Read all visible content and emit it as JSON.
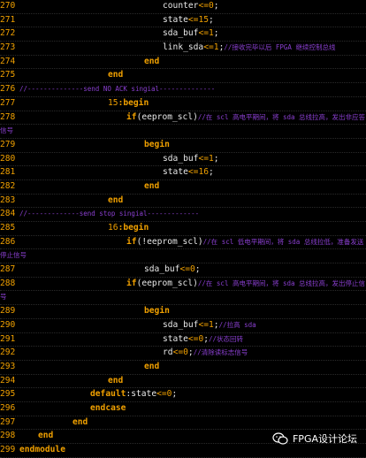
{
  "lines": [
    {
      "ln": "270",
      "indent": 184,
      "parts": [
        [
          "id",
          "counter"
        ],
        [
          "op",
          "<="
        ],
        [
          "num",
          "0"
        ],
        [
          "id",
          ";"
        ]
      ]
    },
    {
      "ln": "271",
      "indent": 184,
      "parts": [
        [
          "id",
          "state"
        ],
        [
          "op",
          "<="
        ],
        [
          "num",
          "15"
        ],
        [
          "id",
          ";"
        ]
      ]
    },
    {
      "ln": "272",
      "indent": 184,
      "parts": [
        [
          "id",
          "sda_buf"
        ],
        [
          "op",
          "<="
        ],
        [
          "num",
          "1"
        ],
        [
          "id",
          ";"
        ]
      ]
    },
    {
      "ln": "273",
      "indent": 184,
      "parts": [
        [
          "id",
          "link_sda"
        ],
        [
          "op",
          "<="
        ],
        [
          "num",
          "1"
        ],
        [
          "id",
          ";"
        ],
        [
          "cmt",
          "//接收完毕以后 FPGA 继续控制总线"
        ]
      ]
    },
    {
      "ln": "274",
      "indent": 163,
      "parts": [
        [
          "kw",
          "end"
        ]
      ]
    },
    {
      "ln": "275",
      "indent": 122,
      "parts": [
        [
          "kw",
          "end"
        ]
      ]
    },
    {
      "ln": "276",
      "indent": 22,
      "parts": [
        [
          "cmt",
          "//--------------send NO ACK singial--------------"
        ]
      ]
    },
    {
      "ln": "277",
      "indent": 122,
      "parts": [
        [
          "num",
          "15"
        ],
        [
          "kw",
          ":begin"
        ]
      ]
    },
    {
      "ln": "278",
      "indent": 143,
      "parts": [
        [
          "kw",
          "if"
        ],
        [
          "id",
          "(eeprom_scl)"
        ],
        [
          "cmt",
          "//在 scl 高电平期间，将 sda 总线拉高，发出非应答"
        ]
      ]
    },
    {
      "ln": "",
      "indent": 0,
      "parts": [
        [
          "cmt",
          "信号"
        ]
      ]
    },
    {
      "ln": "279",
      "indent": 163,
      "parts": [
        [
          "kw",
          "begin"
        ]
      ]
    },
    {
      "ln": "280",
      "indent": 184,
      "parts": [
        [
          "id",
          "sda_buf"
        ],
        [
          "op",
          "<="
        ],
        [
          "num",
          "1"
        ],
        [
          "id",
          ";"
        ]
      ]
    },
    {
      "ln": "281",
      "indent": 184,
      "parts": [
        [
          "id",
          "state"
        ],
        [
          "op",
          "<="
        ],
        [
          "num",
          "16"
        ],
        [
          "id",
          ";"
        ]
      ]
    },
    {
      "ln": "282",
      "indent": 163,
      "parts": [
        [
          "kw",
          "end"
        ]
      ]
    },
    {
      "ln": "283",
      "indent": 122,
      "parts": [
        [
          "kw",
          "end"
        ]
      ]
    },
    {
      "ln": "284",
      "indent": 22,
      "parts": [
        [
          "cmt",
          "//-------------send stop singial-------------"
        ]
      ]
    },
    {
      "ln": "285",
      "indent": 122,
      "parts": [
        [
          "num",
          "16"
        ],
        [
          "kw",
          ":begin"
        ]
      ]
    },
    {
      "ln": "286",
      "indent": 143,
      "parts": [
        [
          "kw",
          "if"
        ],
        [
          "id",
          "(!eeprom_scl)"
        ],
        [
          "cmt",
          "//在 scl 低电平期间，将 sda 总线拉低，准备发送"
        ]
      ]
    },
    {
      "ln": "",
      "indent": 0,
      "parts": [
        [
          "cmt",
          "停止信号"
        ]
      ]
    },
    {
      "ln": "287",
      "indent": 163,
      "parts": [
        [
          "id",
          "sda_buf"
        ],
        [
          "op",
          "<="
        ],
        [
          "num",
          "0"
        ],
        [
          "id",
          ";"
        ]
      ]
    },
    {
      "ln": "288",
      "indent": 143,
      "parts": [
        [
          "kw",
          "if"
        ],
        [
          "id",
          "(eeprom_scl)"
        ],
        [
          "cmt",
          "//在 scl 高电平期间，将 sda 总线拉高，发出停止信"
        ]
      ]
    },
    {
      "ln": "",
      "indent": 0,
      "parts": [
        [
          "cmt",
          "号"
        ]
      ]
    },
    {
      "ln": "289",
      "indent": 163,
      "parts": [
        [
          "kw",
          "begin"
        ]
      ]
    },
    {
      "ln": "290",
      "indent": 184,
      "parts": [
        [
          "id",
          "sda_buf"
        ],
        [
          "op",
          "<="
        ],
        [
          "num",
          "1"
        ],
        [
          "id",
          ";"
        ],
        [
          "cmt",
          "//拉高 sda"
        ]
      ]
    },
    {
      "ln": "291",
      "indent": 184,
      "parts": [
        [
          "id",
          "state"
        ],
        [
          "op",
          "<="
        ],
        [
          "num",
          "0"
        ],
        [
          "id",
          ";"
        ],
        [
          "cmt",
          "//状态回转"
        ]
      ]
    },
    {
      "ln": "292",
      "indent": 184,
      "parts": [
        [
          "id",
          "rd"
        ],
        [
          "op",
          "<="
        ],
        [
          "num",
          "0"
        ],
        [
          "id",
          ";"
        ],
        [
          "cmt",
          "//清除读标志信号"
        ]
      ]
    },
    {
      "ln": "293",
      "indent": 163,
      "parts": [
        [
          "kw",
          "end"
        ]
      ]
    },
    {
      "ln": "294",
      "indent": 122,
      "parts": [
        [
          "kw",
          "end"
        ]
      ]
    },
    {
      "ln": "295",
      "indent": 102,
      "parts": [
        [
          "kw",
          "default"
        ],
        [
          "id",
          ":state"
        ],
        [
          "op",
          "<="
        ],
        [
          "num",
          "0"
        ],
        [
          "id",
          ";"
        ]
      ]
    },
    {
      "ln": "296",
      "indent": 102,
      "parts": [
        [
          "kw",
          "endcase"
        ]
      ]
    },
    {
      "ln": "297",
      "indent": 82,
      "parts": [
        [
          "kw",
          "end"
        ]
      ]
    },
    {
      "ln": "298",
      "indent": 43,
      "parts": [
        [
          "kw",
          "end"
        ]
      ]
    },
    {
      "ln": "299",
      "indent": 22,
      "parts": [
        [
          "kw",
          "endmodule"
        ]
      ]
    }
  ],
  "watermark": {
    "text": "FPGA设计论坛",
    "icon": "wechat-icon"
  }
}
